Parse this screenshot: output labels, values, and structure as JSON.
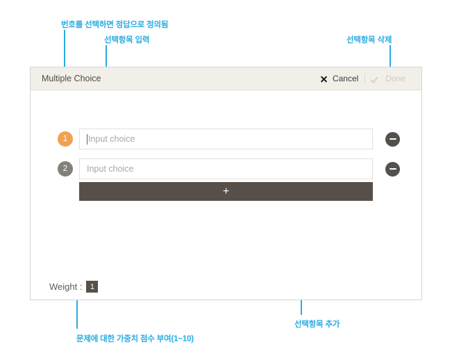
{
  "dialog": {
    "title": "Multiple Choice",
    "cancel_label": "Cancel",
    "done_label": "Done",
    "choices": [
      {
        "number": "1",
        "placeholder": "Input choice",
        "value": "",
        "selected": true
      },
      {
        "number": "2",
        "placeholder": "Input choice",
        "value": "",
        "selected": false
      }
    ],
    "add_label": "+",
    "weight_label": "Weight :",
    "weight_value": "1"
  },
  "annotations": [
    {
      "id": "answer-define",
      "text": "번호를 선택하면 정답으로 정의됨"
    },
    {
      "id": "choice-input",
      "text": "선택항목 입력"
    },
    {
      "id": "choice-delete",
      "text": "선택항목 삭제"
    },
    {
      "id": "choice-add",
      "text": "선택항목 추가"
    },
    {
      "id": "weight-score",
      "text": "문제에 대한 가중치 점수 부여(1~10)"
    }
  ],
  "colors": {
    "annotation": "#29abe2",
    "selected_badge": "#f2a053",
    "normal_badge": "#83807c",
    "dark_bar": "#584f48",
    "titlebar": "#f2efe8"
  }
}
